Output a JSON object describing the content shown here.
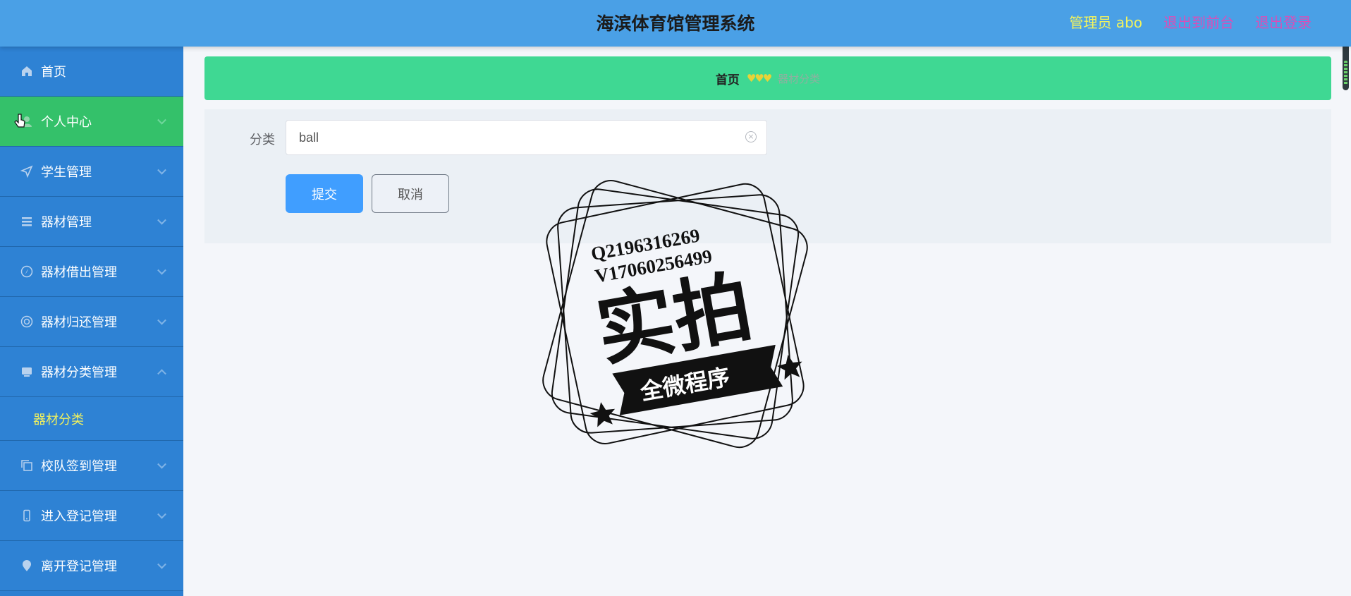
{
  "header": {
    "title": "海滨体育馆管理系统",
    "admin_label": "管理员 abo",
    "exit_front": "退出到前台",
    "logout": "退出登录"
  },
  "sidebar": {
    "items": [
      {
        "label": "首页",
        "icon": "home-icon"
      },
      {
        "label": "个人中心",
        "icon": "user-icon",
        "active": true
      },
      {
        "label": "学生管理",
        "icon": "send-icon"
      },
      {
        "label": "器材管理",
        "icon": "menu-icon"
      },
      {
        "label": "器材借出管理",
        "icon": "compass-icon"
      },
      {
        "label": "器材归还管理",
        "icon": "lifebuoy-icon"
      },
      {
        "label": "器材分类管理",
        "icon": "monitor-icon",
        "expanded": true
      },
      {
        "label": "校队签到管理",
        "icon": "copy-icon"
      },
      {
        "label": "进入登记管理",
        "icon": "phone-icon"
      },
      {
        "label": "离开登记管理",
        "icon": "location-icon"
      }
    ],
    "sub_item": "器材分类"
  },
  "breadcrumb": {
    "home": "首页",
    "separator": "♥♥♥",
    "current": "器材分类"
  },
  "form": {
    "category_label": "分类",
    "category_value": "ball",
    "submit_label": "提交",
    "cancel_label": "取消"
  },
  "watermark": {
    "line1": "Q2196316269",
    "line2": "V17060256499",
    "main": "实拍",
    "banner": "全微程序"
  },
  "colors": {
    "header_bg": "#4aa0e6",
    "sidebar_bg": "#2e82d4",
    "active_bg": "#34c16a",
    "breadcrumb_bg": "#3fd893",
    "submit_bg": "#409eff"
  }
}
